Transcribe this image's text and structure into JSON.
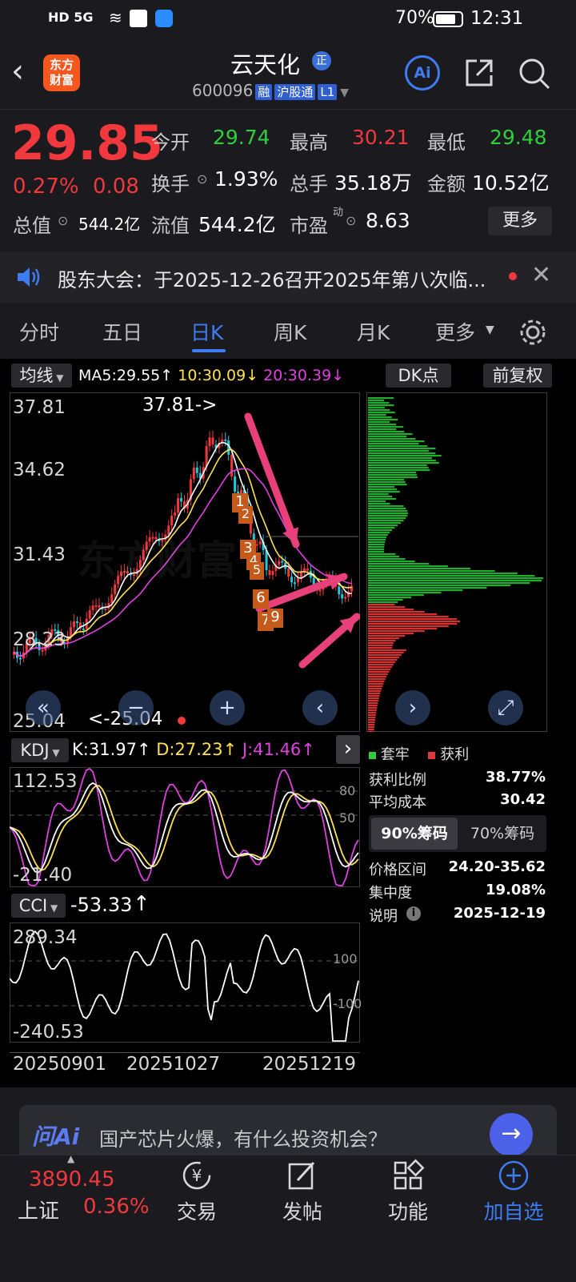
{
  "status": {
    "left_icons": "HD 5G",
    "battery": "70%",
    "time": "12:31"
  },
  "header": {
    "logo_line1": "东方",
    "logo_line2": "财富",
    "title": "云天化",
    "badge": "正",
    "code": "600096",
    "tag1": "融",
    "tag2": "沪股通",
    "tag3": "L1",
    "ai_label": "Ai"
  },
  "quote": {
    "price": "29.85",
    "change_pct": "0.27%",
    "change": "0.08",
    "open_label": "今开",
    "open": "29.74",
    "high_label": "最高",
    "high": "30.21",
    "low_label": "最低",
    "low": "29.48",
    "turnover_label": "换手",
    "turnover": "1.93%",
    "volume_label": "总手",
    "volume": "35.18万",
    "amount_label": "金额",
    "amount": "10.52亿",
    "mktcap_label": "总值",
    "mktcap": "544.2亿",
    "float_label": "流值",
    "float": "544.2亿",
    "pe_label": "市盈",
    "pe_sup": "动",
    "pe": "8.63",
    "more_label": "更多"
  },
  "notice": {
    "text": "股东大会：于2025-12-26召开2025年第八次临..."
  },
  "tabs": [
    "分时",
    "五日",
    "日K",
    "周K",
    "月K",
    "更多"
  ],
  "main_chart": {
    "ma_button": "均线",
    "ma5": "MA5:29.55",
    "ma10": "10:30.09",
    "ma20": "20:30.39",
    "dk_label": "DK点",
    "adjust_label": "前复权",
    "y_labels": [
      "37.81",
      "34.62",
      "31.43",
      "28.23",
      "25.04"
    ],
    "high_marker": "37.81->",
    "low_marker": "<-25.04",
    "signal_numbers": [
      "1",
      "2",
      "3",
      "4",
      "5",
      "6",
      "7",
      "9"
    ],
    "watermark": "东方财富"
  },
  "kdj": {
    "name": "KDJ",
    "k": "K:31.97",
    "d": "D:27.23",
    "j": "J:41.46",
    "y_top": "112.53",
    "y_bottom": "-21.40",
    "ref1": "80",
    "ref2": "50"
  },
  "cci": {
    "name": "CCI",
    "value": "-53.33",
    "y_top": "289.34",
    "y_bottom": "-240.53",
    "ref1": "100",
    "ref2": "-100"
  },
  "dates": [
    "20250901",
    "20251027",
    "20251219"
  ],
  "chips": {
    "legend_trapped": "套牢",
    "legend_profit": "获利",
    "rows": [
      {
        "label": "获利比例",
        "value": "38.77%"
      },
      {
        "label": "平均成本",
        "value": "30.42"
      }
    ],
    "tab_90": "90%筹码",
    "tab_70": "70%筹码",
    "rows2": [
      {
        "label": "价格区间",
        "value": "24.20-35.62"
      },
      {
        "label": "集中度",
        "value": "19.08%"
      },
      {
        "label": "说明",
        "value": "2025-12-19"
      }
    ]
  },
  "ask": {
    "brand": "问Ai",
    "placeholder": "国产芯片火爆，有什么投资机会？"
  },
  "bottom": {
    "index_value": "3890.45",
    "index_name": "上证",
    "index_pct": "0.36%",
    "nav": [
      "交易",
      "发帖",
      "功能",
      "加自选"
    ]
  },
  "colors": {
    "up": "#f0383d",
    "down": "#2fcf3c",
    "accent": "#3d7cf2",
    "arrow": "#e8407a"
  }
}
